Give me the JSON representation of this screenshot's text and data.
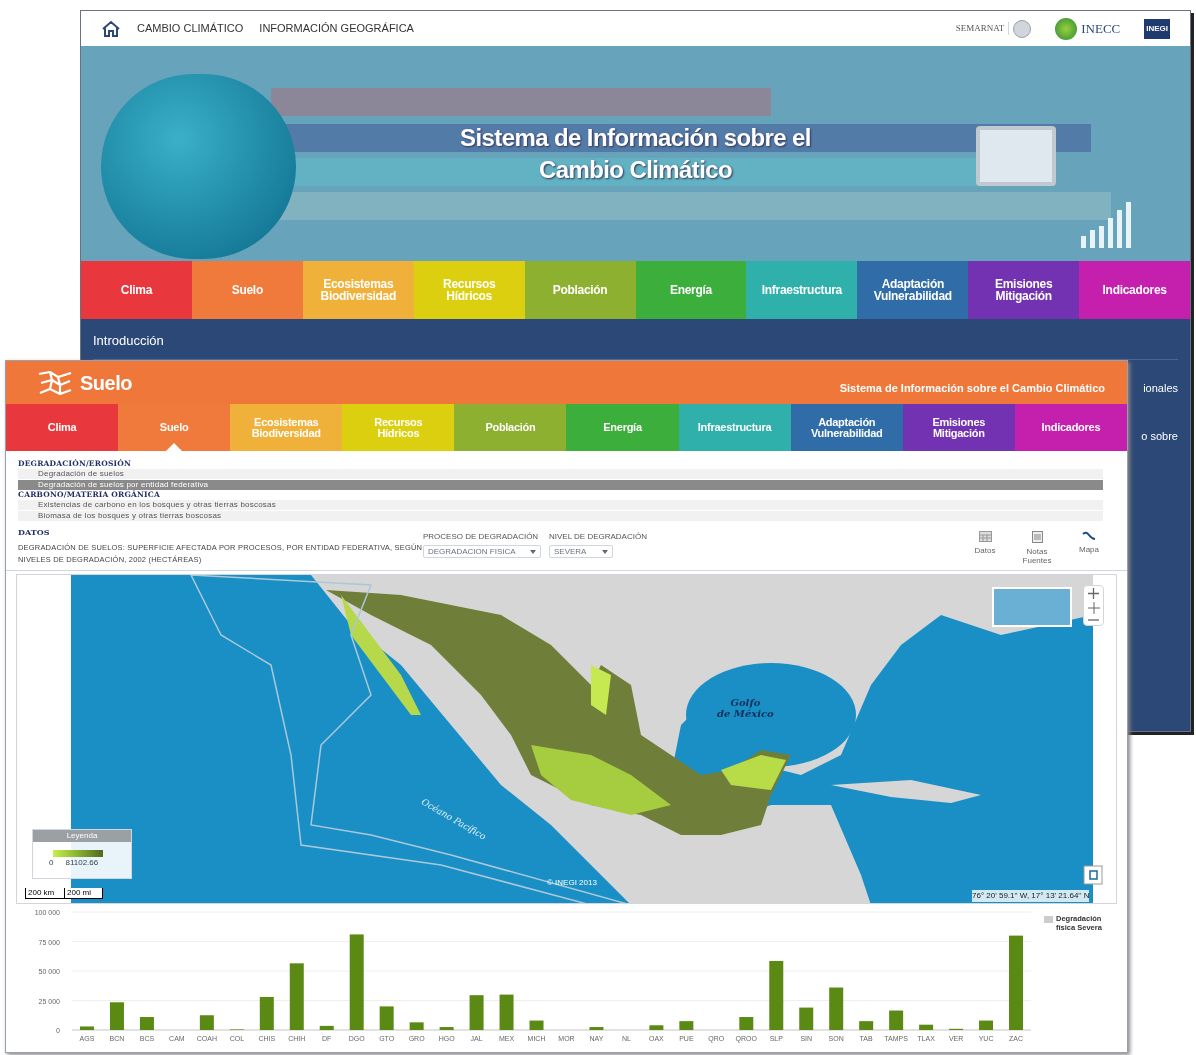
{
  "back_window": {
    "header_links": [
      "CAMBIO CLIMÁTICO",
      "INFORMACIÓN GEOGRÁFICA"
    ],
    "logos": [
      {
        "kind": "semarnat",
        "text": "SEMARNAT"
      },
      {
        "kind": "inecc",
        "text": "INECC"
      },
      {
        "kind": "inegi",
        "text": "INEGI"
      }
    ],
    "banner_title": [
      "Sistema de Información sobre el",
      "Cambio Climático"
    ],
    "nav": [
      {
        "lines": [
          "Clima"
        ],
        "color": "#e8383d"
      },
      {
        "lines": [
          "Suelo"
        ],
        "color": "#f07a3c"
      },
      {
        "lines": [
          "Ecosistemas",
          "Biodiversidad"
        ],
        "color": "#f0b13b"
      },
      {
        "lines": [
          "Recursos",
          "Hídricos"
        ],
        "color": "#dccf10"
      },
      {
        "lines": [
          "Población"
        ],
        "color": "#8eb030"
      },
      {
        "lines": [
          "Energía"
        ],
        "color": "#3cae3c"
      },
      {
        "lines": [
          "Infraestructura"
        ],
        "color": "#2fb0aa"
      },
      {
        "lines": [
          "Adaptación",
          "Vulnerabilidad"
        ],
        "color": "#2f6ca8"
      },
      {
        "lines": [
          "Emisiones",
          "Mitigación"
        ],
        "color": "#7232b2"
      },
      {
        "lines": [
          "Indicadores"
        ],
        "color": "#c51fae"
      }
    ],
    "submenu": "Introducción",
    "cut_texts": [
      "ionales",
      "o sobre"
    ]
  },
  "front_window": {
    "section_title": "Suelo",
    "site_title": "Sistema de Información sobre el Cambio Climático",
    "nav": [
      {
        "lines": [
          "Clima"
        ],
        "color": "#e8383d",
        "selected": false
      },
      {
        "lines": [
          "Suelo"
        ],
        "color": "#f07a3c",
        "selected": true
      },
      {
        "lines": [
          "Ecosistemas",
          "Biodiversidad"
        ],
        "color": "#f0b13b",
        "selected": false
      },
      {
        "lines": [
          "Recursos",
          "Hídricos"
        ],
        "color": "#dccf10",
        "selected": false
      },
      {
        "lines": [
          "Población"
        ],
        "color": "#8eb030",
        "selected": false
      },
      {
        "lines": [
          "Energía"
        ],
        "color": "#3cae3c",
        "selected": false
      },
      {
        "lines": [
          "Infraestructura"
        ],
        "color": "#2fb0aa",
        "selected": false
      },
      {
        "lines": [
          "Adaptación",
          "Vulnerabilidad"
        ],
        "color": "#2f6ca8",
        "selected": false
      },
      {
        "lines": [
          "Emisiones",
          "Mitigación"
        ],
        "color": "#7232b2",
        "selected": false
      },
      {
        "lines": [
          "Indicadores"
        ],
        "color": "#c51fae",
        "selected": false
      }
    ],
    "menu": [
      {
        "heading": "DEGRADACIÓN/EROSIÓN",
        "items": [
          {
            "label": "Degradación de suelos",
            "selected": false
          },
          {
            "label": "Degradación de suelos por entidad federativa",
            "selected": true
          }
        ]
      },
      {
        "heading": "CARBONO/MATERIA ORGÁNICA",
        "items": [
          {
            "label": "Existencias de carbono en los bosques y otras tierras boscosas",
            "selected": false
          },
          {
            "label": "Biomasa de los bosques y otras tierras boscosas",
            "selected": false
          }
        ]
      }
    ],
    "datos_heading": "DATOS",
    "dataset_title": "DEGRADACIÓN DE SUELOS: SUPERFICIE AFECTADA POR PROCESOS, POR ENTIDAD FEDERATIVA, SEGÚN NIVELES DE DEGRADACIÓN, 2002 (HECTÁREAS)",
    "filters": [
      {
        "label": "PROCESO DE DEGRADACIÓN",
        "value": "DEGRADACION FISICA"
      },
      {
        "label": "NIVEL DE DEGRADACIÓN",
        "value": "SEVERA"
      }
    ],
    "tools": [
      {
        "kind": "table",
        "label": "Datos"
      },
      {
        "kind": "notes",
        "label": "Notas Fuentes"
      },
      {
        "kind": "map",
        "label": "Mapa"
      }
    ],
    "map": {
      "gulf_label": [
        "Golfo",
        "de México"
      ],
      "ocean_label": "Océano Pacífico",
      "copyright": "© INEGI 2013",
      "coordinates": "76° 20' 59.1'' W, 17° 13' 21.64'' N",
      "legend_title": "Leyenda",
      "legend_min": "0",
      "legend_max": "81102.66",
      "scale_km": "200 km",
      "scale_mi": "200 mi"
    },
    "chart": {
      "chart_data": {
        "type": "bar",
        "categories": [
          "AGS",
          "BCN",
          "BCS",
          "CAM",
          "COAH",
          "COL",
          "CHIS",
          "CHIH",
          "DF",
          "DGO",
          "GTO",
          "GRO",
          "HGO",
          "JAL",
          "MEX",
          "MICH",
          "MOR",
          "NAY",
          "NL",
          "OAX",
          "PUE",
          "QRO",
          "QROO",
          "SLP",
          "SIN",
          "SON",
          "TAB",
          "TAMPS",
          "TLAX",
          "VER",
          "YUC",
          "ZAC"
        ],
        "series": [
          {
            "name": "Degradación física Severa",
            "color": "#5a8a14",
            "values": [
              3000,
              23500,
              11000,
              0,
              12500,
              500,
              28000,
              56500,
              3500,
              81000,
              20000,
              6500,
              2500,
              29500,
              30000,
              8000,
              0,
              2500,
              0,
              4000,
              7500,
              0,
              11000,
              58500,
              19000,
              36000,
              7500,
              16500,
              4500,
              1000,
              8000,
              80000
            ]
          }
        ],
        "ylim": [
          0,
          100000
        ],
        "grid": true,
        "yticks": [
          {
            "value": 0,
            "label": "0"
          },
          {
            "value": 25000,
            "label": "25 000"
          },
          {
            "value": 50000,
            "label": "50 000"
          },
          {
            "value": 75000,
            "label": "75 000"
          },
          {
            "value": 100000,
            "label": "100 000"
          }
        ]
      }
    }
  }
}
